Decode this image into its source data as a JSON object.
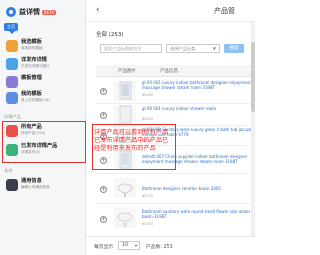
{
  "app": {
    "name": "益详情",
    "badge": "BETA",
    "tooltip": "主页"
  },
  "sidebar": {
    "nav_top": [
      {
        "title": "我选模板",
        "sub": "我选择的模板",
        "icon": "grid-icon",
        "color": "#f0a13c"
      },
      {
        "title": "详发布详情",
        "sub": "已发布详情与图片",
        "icon": "document-icon",
        "color": "#4aa3e8"
      },
      {
        "title": "模板管理",
        "sub": "",
        "icon": "layout-icon",
        "color": "#8a7ad6"
      },
      {
        "title": "我的模板",
        "sub": "我上传的模板(16)",
        "icon": "user-template-icon",
        "color": "#5e8ee0"
      }
    ],
    "section_products": "详情产品",
    "nav_products": [
      {
        "title": "所有产品",
        "sub": "所有产品(253)",
        "icon": "box-icon",
        "color": "#e7534a"
      },
      {
        "title": "已发布详情产品",
        "sub": "详情发布(5)",
        "icon": "published-icon",
        "color": "#3bb27c"
      }
    ],
    "section_other": "其他",
    "nav_other": [
      {
        "title": "通用信息",
        "sub": "编辑公司通用信息",
        "icon": "info-icon",
        "color": "#3a3f4b"
      }
    ]
  },
  "main": {
    "title": "产品管",
    "back_label": "‹",
    "count_label": "全部 (253)",
    "search_placeholder": "搜索产品标题或货号",
    "category_select": "选择产品分类",
    "search_button": "搜索",
    "table": {
      "col_image": "产品图片",
      "col_info": "产品信息"
    },
    "rows": [
      {
        "title": "gl 00 001 luxury indoor bathroom designer enjoyment massage shower steam room 3198T",
        "price": "¥0.00",
        "thumb": "shower-cabin-icon"
      },
      {
        "title": "gl 00 001 luxury indoor shower room",
        "price": "¥0.00",
        "thumb": "shower-cabin-icon"
      },
      {
        "title": "gl 00 008 Sanitary ware luxury glass 4 bath tub jacuzzi various size table 6779",
        "price": "¥0.00",
        "thumb": "bathtub-icon"
      },
      {
        "title": "ddmdt 007 China supplier indoor bathroom designer enjoyment massage shower steam room 3198T",
        "price": "¥0.00",
        "thumb": "shower-cabin-icon"
      },
      {
        "title": "Bathroom designer ceramic basin 3405",
        "price": "¥0.00",
        "thumb": "basin-icon"
      },
      {
        "title": "Bathroom sanitary ware round small flower size water basin 3198T",
        "price": "¥0.00",
        "thumb": "basin-icon"
      }
    ],
    "overlay_note": "详情产品可以看到所有产品 已发布详情产品中的产品已经是利用来发布的产品",
    "footer": {
      "per_page_label": "每页显示",
      "per_page_value": "10",
      "total": "产品数: 253"
    }
  }
}
